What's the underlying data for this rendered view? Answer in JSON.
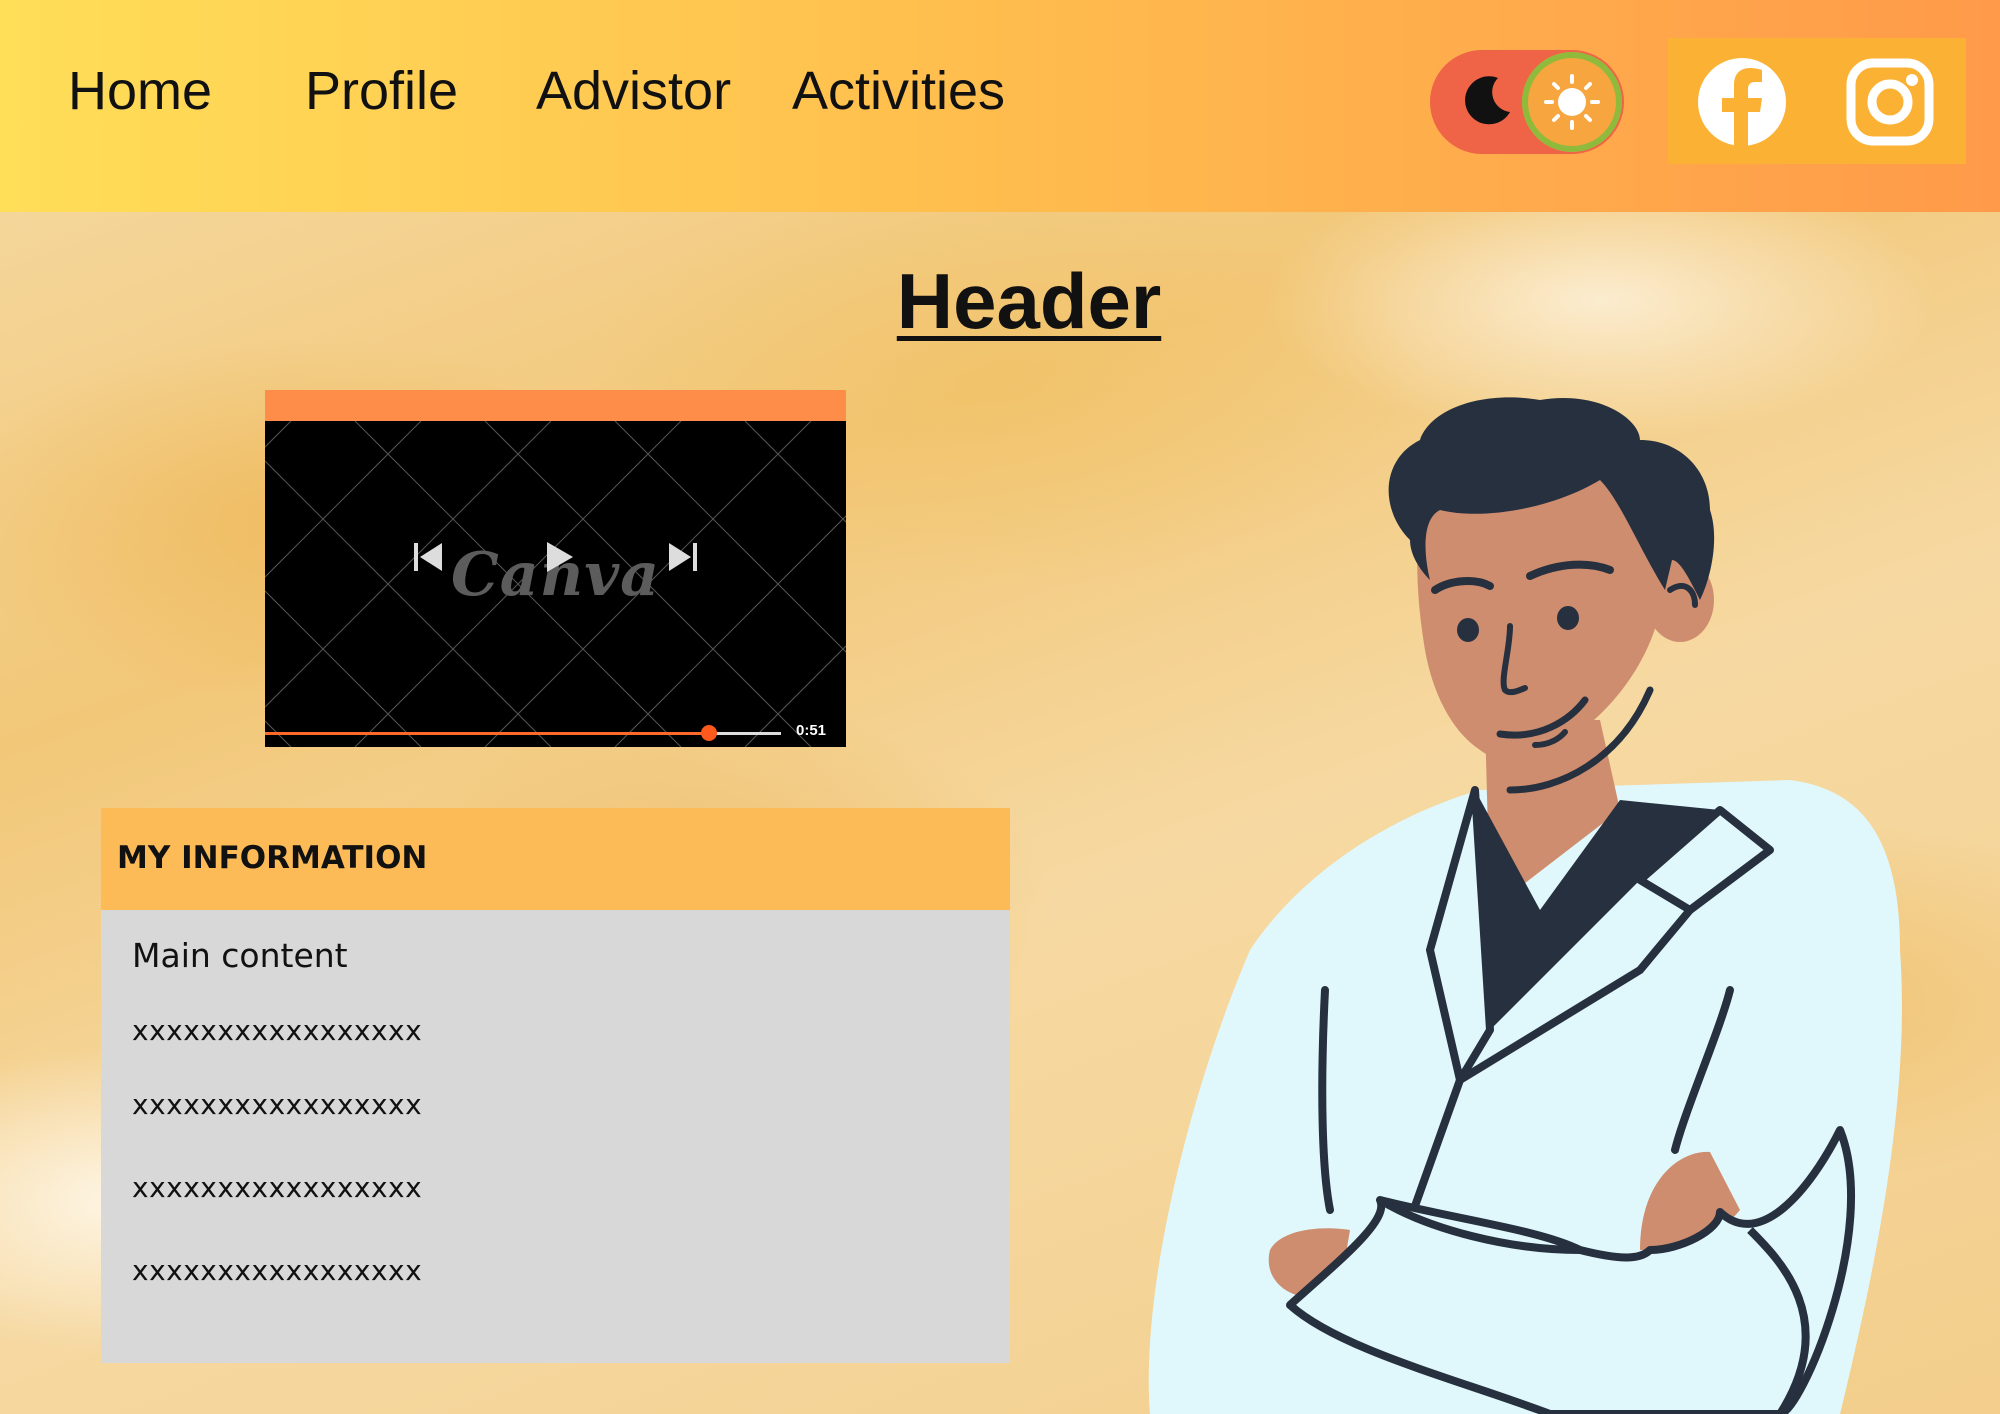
{
  "nav": {
    "items": [
      {
        "label": "Home"
      },
      {
        "label": "Profile"
      },
      {
        "label": "Advistor"
      },
      {
        "label": "Activities"
      }
    ]
  },
  "theme_toggle": {
    "state": "light",
    "icons": [
      "moon-icon",
      "sun-icon"
    ]
  },
  "social": {
    "icons": [
      "facebook-icon",
      "instagram-icon"
    ]
  },
  "header": {
    "title": "Header"
  },
  "video": {
    "watermark": "Canva",
    "time": "0:51",
    "progress": 0.86,
    "controls": [
      "previous-icon",
      "play-icon",
      "next-icon"
    ]
  },
  "info_card": {
    "title": "MY INFORMATION",
    "main_label": "Main content",
    "lines": [
      "xxxxxxxxxxxxxxxxx",
      "xxxxxxxxxxxxxxxxx",
      "xxxxxxxxxxxxxxxxx",
      "xxxxxxxxxxxxxxxxx"
    ]
  },
  "colors": {
    "topbar_start": "#ffde58",
    "topbar_end": "#ff9a4a",
    "toggle": "#ef6346",
    "social_box": "#fbb234",
    "video_bar": "#ff8d4a",
    "card_header": "#fdbb58",
    "card_body": "#d8d8d8",
    "coat": "#e0f8fb",
    "hair": "#27303f",
    "skin": "#cf8d6f"
  }
}
